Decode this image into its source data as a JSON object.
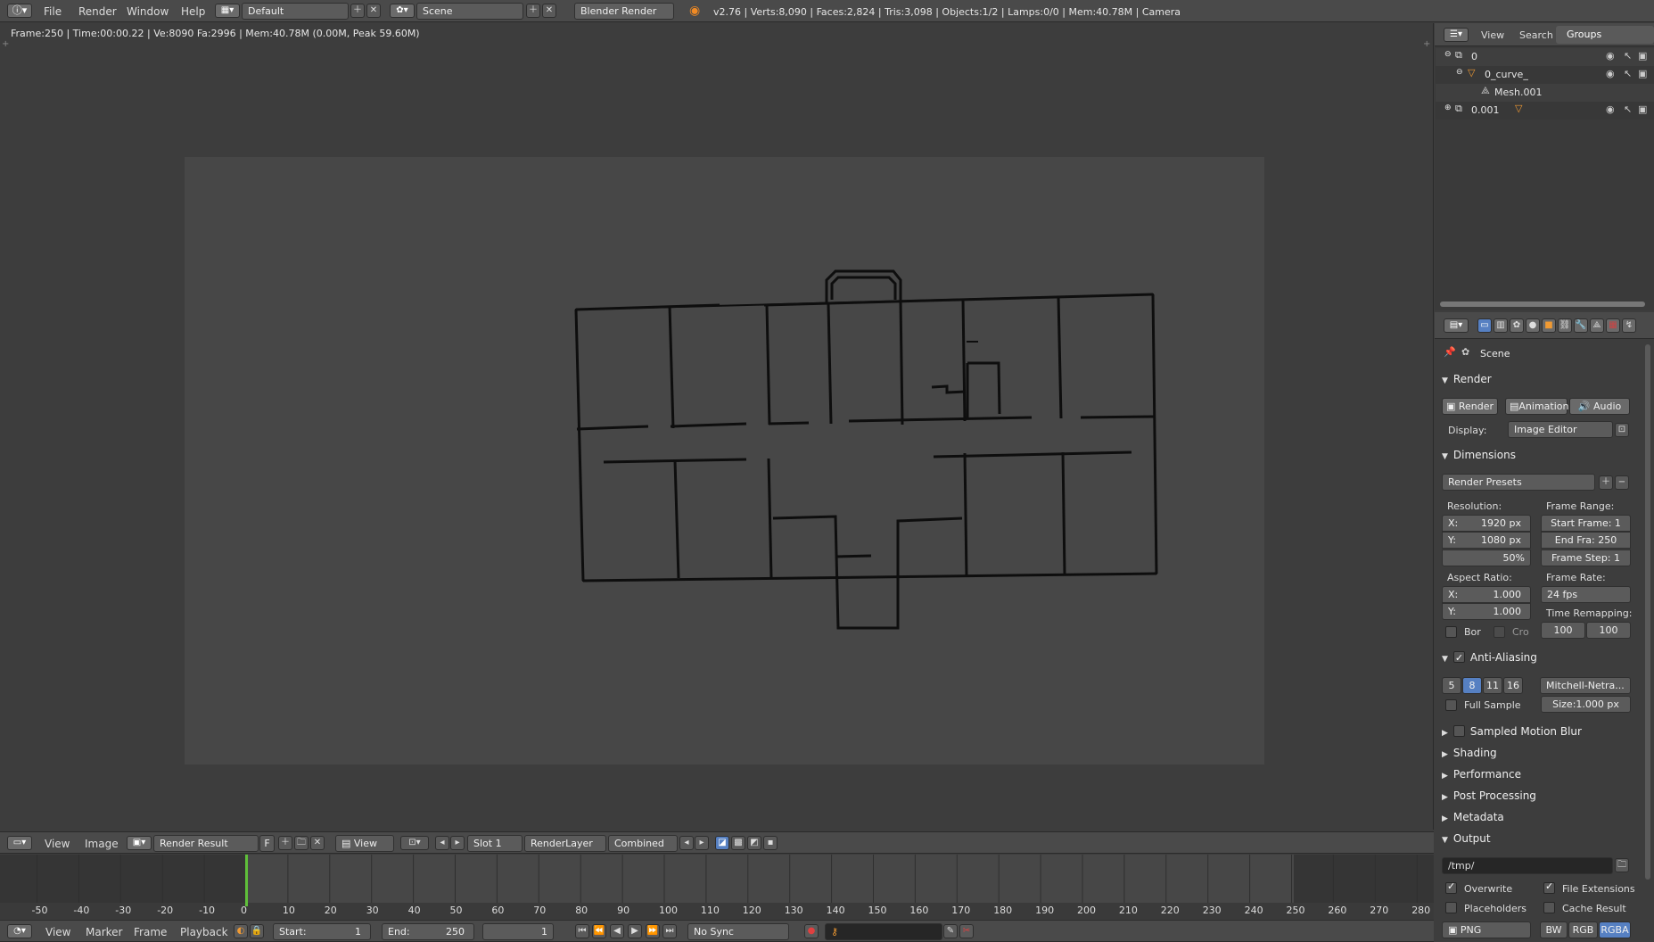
{
  "top": {
    "menus": [
      "File",
      "Render",
      "Window",
      "Help"
    ],
    "layout": "Default",
    "scene": "Scene",
    "engine": "Blender Render",
    "stats": "v2.76 | Verts:8,090 | Faces:2,824 | Tris:3,098 | Objects:1/2 | Lamps:0/0 | Mem:40.78M | Camera"
  },
  "viewport": {
    "render_info": "Frame:250 | Time:00:00.22 | Ve:8090 Fa:2996 | Mem:40.78M (0.00M, Peak 59.60M)"
  },
  "outliner": {
    "tabs": [
      "View",
      "Search",
      "Groups"
    ],
    "items": [
      {
        "label": "0"
      },
      {
        "label": "0_curve_"
      },
      {
        "label": "Mesh.001"
      },
      {
        "label": "0.001"
      }
    ]
  },
  "props": {
    "scene_label": "Scene",
    "render_header": "Render",
    "render_btn": "Render",
    "animation_btn": "Animation",
    "audio_btn": "Audio",
    "display_label": "Display:",
    "display_value": "Image Editor",
    "dimensions_header": "Dimensions",
    "render_presets": "Render Presets",
    "resolution_label": "Resolution:",
    "res_x": "X:",
    "res_x_val": "1920 px",
    "res_y": "Y:",
    "res_y_val": "1080 px",
    "res_pct": "50%",
    "frame_range_label": "Frame Range:",
    "start_frame": "Start Frame: 1",
    "end_frame": "End Fra:  250",
    "frame_step": "Frame Step: 1",
    "aspect_label": "Aspect Ratio:",
    "asp_x": "X:",
    "asp_x_val": "1.000",
    "asp_y": "Y:",
    "asp_y_val": "1.000",
    "frame_rate_label": "Frame Rate:",
    "frame_rate": "24 fps",
    "time_remap_label": "Time Remapping:",
    "remap_old": "100",
    "remap_new": "100",
    "border": "Bor",
    "crop": "Cro",
    "aa_header": "Anti-Aliasing",
    "aa_samples": [
      "5",
      "8",
      "11",
      "16"
    ],
    "aa_filter": "Mitchell-Netra...",
    "full_sample": "Full Sample",
    "aa_size": "Size:1.000 px",
    "motion_blur": "Sampled Motion Blur",
    "shading": "Shading",
    "performance": "Performance",
    "post_processing": "Post Processing",
    "metadata": "Metadata",
    "output": "Output",
    "output_path": "/tmp/",
    "overwrite": "Overwrite",
    "file_ext": "File Extensions",
    "placeholders": "Placeholders",
    "cache_result": "Cache Result",
    "format": "PNG",
    "bw": "BW",
    "rgb": "RGB",
    "rgba": "RGBA"
  },
  "image_editor": {
    "menus": [
      "View",
      "Image"
    ],
    "image_name": "Render Result",
    "f_label": "F",
    "view": "View",
    "slot": "Slot 1",
    "layer": "RenderLayer",
    "pass": "Combined"
  },
  "timeline": {
    "ticks": [
      "-50",
      "-40",
      "-30",
      "-20",
      "-10",
      "0",
      "10",
      "20",
      "30",
      "40",
      "50",
      "60",
      "70",
      "80",
      "90",
      "100",
      "110",
      "120",
      "130",
      "140",
      "150",
      "160",
      "170",
      "180",
      "190",
      "200",
      "210",
      "220",
      "230",
      "240",
      "250",
      "260",
      "270",
      "280"
    ],
    "current_frame": 0,
    "menus": [
      "View",
      "Marker",
      "Frame",
      "Playback"
    ],
    "start": "Start:",
    "start_val": "1",
    "end": "End:",
    "end_val": "250",
    "frame": "1",
    "sync": "No Sync"
  },
  "colors": {
    "accent": "#5680c2",
    "playhead": "#5fbf3a",
    "bg": "#3d3d3d"
  }
}
